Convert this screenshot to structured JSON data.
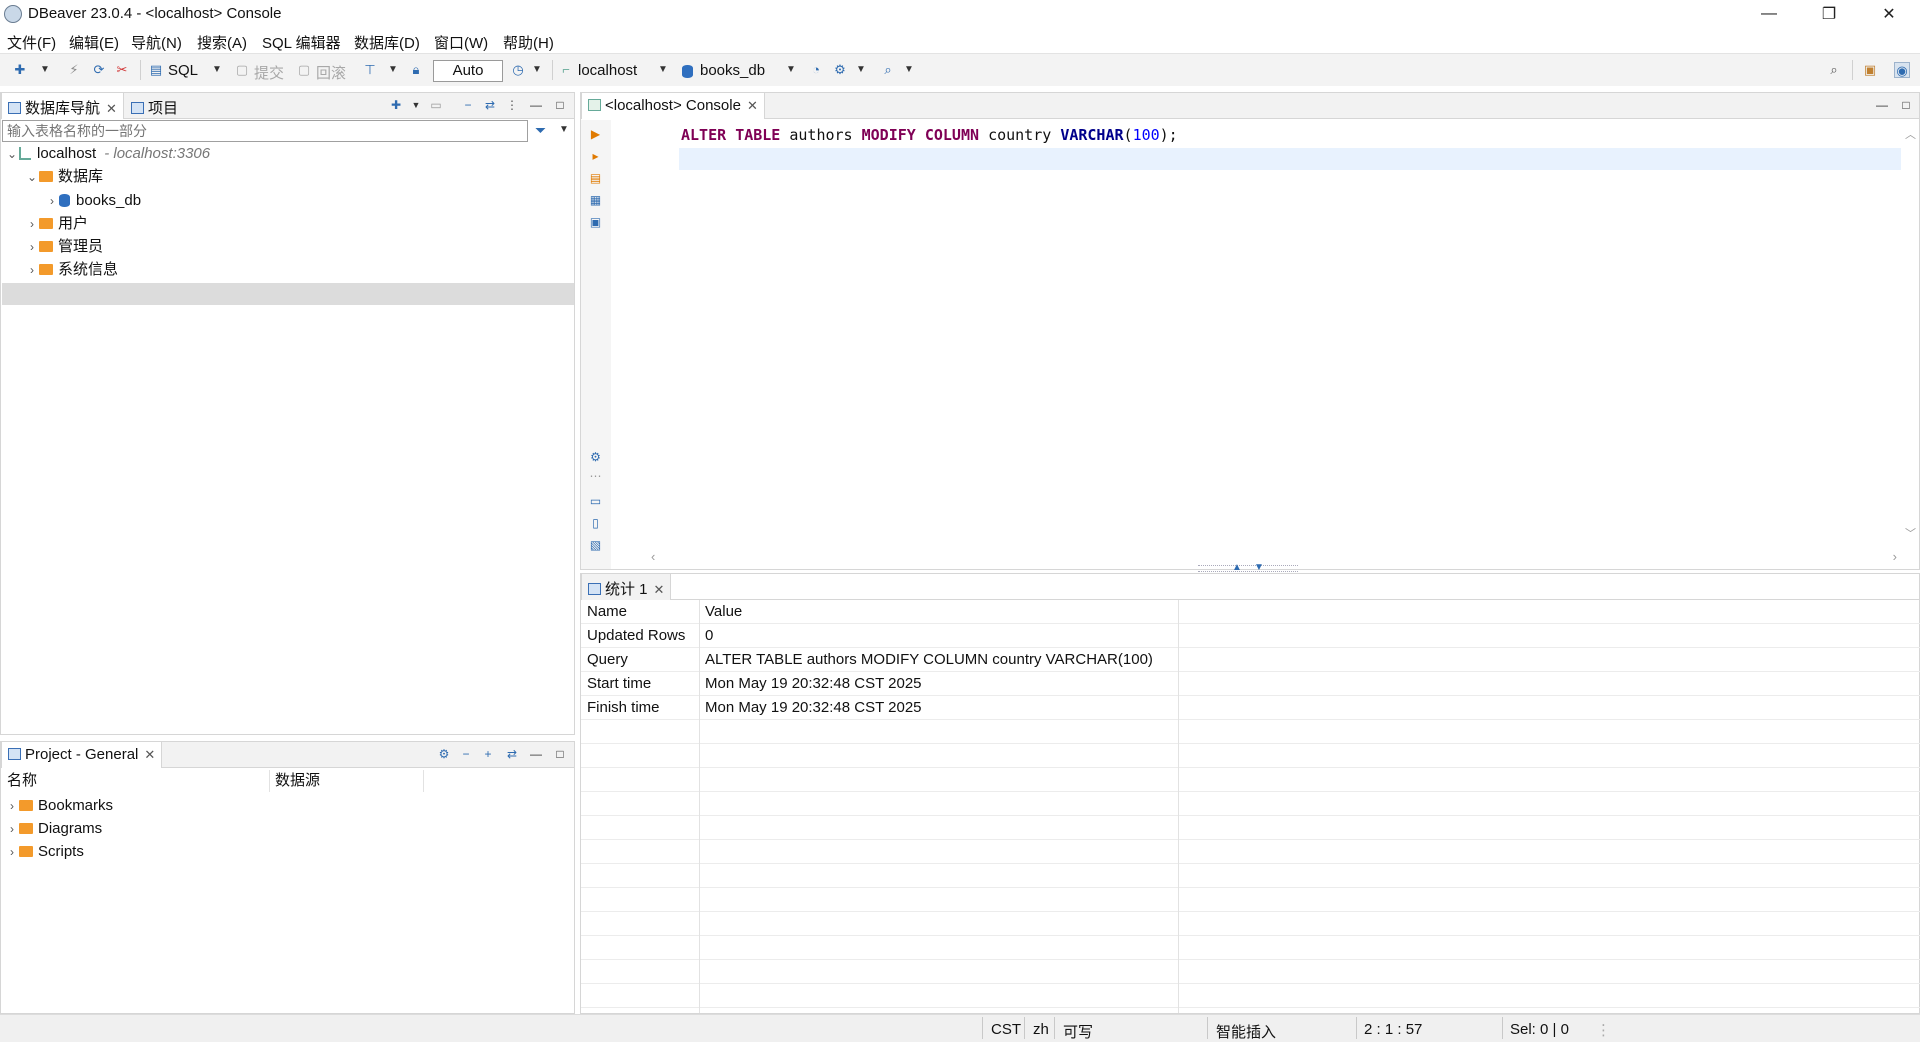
{
  "window": {
    "title": "DBeaver 23.0.4 - <localhost> Console",
    "minimize_glyph": "—",
    "restore_glyph": "❐",
    "close_glyph": "✕"
  },
  "menu": [
    "文件(F)",
    "编辑(E)",
    "导航(N)",
    "搜索(A)",
    "SQL 编辑器",
    "数据库(D)",
    "窗口(W)",
    "帮助(H)"
  ],
  "toolbar": {
    "sql_label": "SQL",
    "commit_label": "提交",
    "rollback_label": "回滚",
    "transaction_mode": "Auto",
    "datasource": "localhost",
    "database": "books_db"
  },
  "navigator": {
    "tab_label": "数据库导航",
    "projects_tab_label": "项目",
    "filter_placeholder": "输入表格名称的一部分",
    "tree": {
      "connection": "localhost",
      "connection_detail": "- localhost:3306",
      "databases_folder": "数据库",
      "database": "books_db",
      "users": "用户",
      "admins": "管理员",
      "system_info": "系统信息"
    }
  },
  "project_panel": {
    "tab_label": "Project - General",
    "columns": [
      "名称",
      "数据源"
    ],
    "items": [
      "Bookmarks",
      "Diagrams",
      "Scripts"
    ]
  },
  "editor": {
    "tab_label": "<localhost> Console",
    "sql": {
      "kw1": "ALTER",
      "kw2": "TABLE",
      "table": "authors",
      "kw3": "MODIFY",
      "kw4": "COLUMN",
      "column": "country",
      "type": "VARCHAR",
      "open": "(",
      "size": "100",
      "close": ");"
    }
  },
  "results": {
    "tab_label": "统计 1",
    "header": {
      "name": "Name",
      "value": "Value"
    },
    "rows": [
      {
        "name": "Updated Rows",
        "value": "0"
      },
      {
        "name": "Query",
        "value": "ALTER TABLE authors MODIFY COLUMN country VARCHAR(100)"
      },
      {
        "name": "Start time",
        "value": "Mon May 19 20:32:48 CST 2025"
      },
      {
        "name": "Finish time",
        "value": "Mon May 19 20:32:48 CST 2025"
      }
    ]
  },
  "statusbar": {
    "timezone": "CST",
    "locale": "zh",
    "write_mode": "可写",
    "insert_mode": "智能插入",
    "cursor": "2 : 1 : 57",
    "selection": "Sel: 0 | 0"
  },
  "colors": {
    "keyword": "#7f0055",
    "function": "#00008b",
    "number": "#0000ff",
    "current_line": "#e8f2fe",
    "folder": "#f39a2b"
  }
}
